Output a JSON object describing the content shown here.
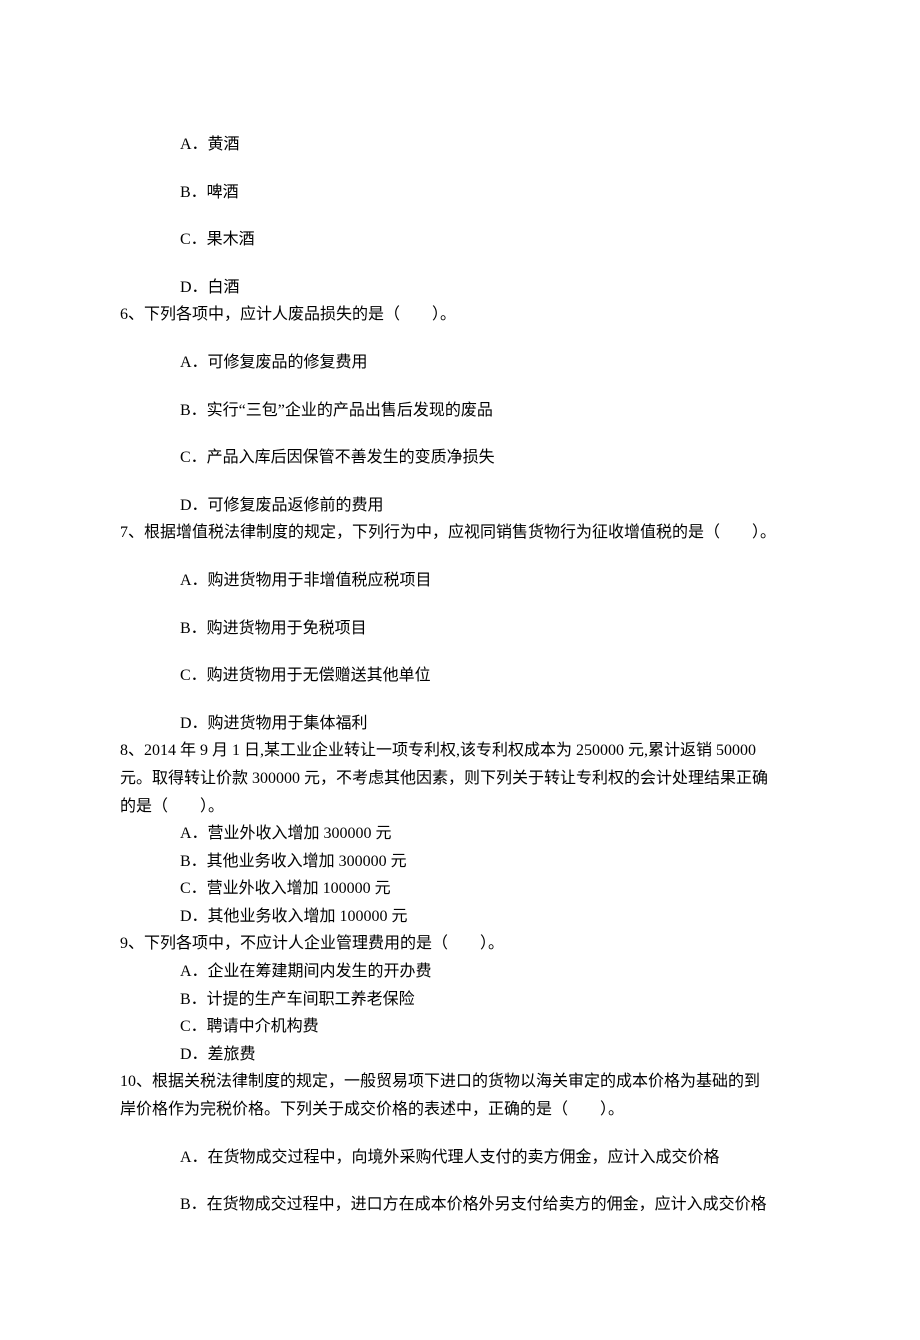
{
  "q5_tail": {
    "options": {
      "A": "A．黄酒",
      "B": "B．啤酒",
      "C": "C．果木酒",
      "D": "D．白酒"
    }
  },
  "q6": {
    "stem": "6、下列各项中，应计人废品损失的是（　　）。",
    "options": {
      "A": "A．可修复废品的修复费用",
      "B": "B．实行“三包”企业的产品出售后发现的废品",
      "C": "C．产品入库后因保管不善发生的变质净损失",
      "D": "D．可修复废品返修前的费用"
    }
  },
  "q7": {
    "stem": "7、根据增值税法律制度的规定，下列行为中，应视同销售货物行为征收增值税的是（　　）。",
    "options": {
      "A": "A．购进货物用于非增值税应税项目",
      "B": "B．购进货物用于免税项目",
      "C": "C．购进货物用于无偿赠送其他单位",
      "D": "D．购进货物用于集体福利"
    }
  },
  "q8": {
    "stem_line1": "8、2014 年 9 月 1 日,某工业企业转让一项专利权,该专利权成本为 250000 元,累计返销 50000",
    "stem_line2": "元。取得转让价款 300000 元，不考虑其他因素，则下列关于转让专利权的会计处理结果正确",
    "stem_line3": "的是（　　）。",
    "options": {
      "A": "A．营业外收入增加 300000 元",
      "B": "B．其他业务收入增加 300000 元",
      "C": "C．营业外收入增加 100000 元",
      "D": "D．其他业务收入增加 100000 元"
    }
  },
  "q9": {
    "stem": "9、下列各项中，不应计人企业管理费用的是（　　）。",
    "options": {
      "A": "A．企业在筹建期间内发生的开办费",
      "B": "B．计提的生产车间职工养老保险",
      "C": "C．聘请中介机构费",
      "D": "D．差旅费"
    }
  },
  "q10": {
    "stem_line1": "10、根据关税法律制度的规定，一般贸易项下进口的货物以海关审定的成本价格为基础的到",
    "stem_line2": "岸价格作为完税价格。下列关于成交价格的表述中，正确的是（　　）。",
    "options": {
      "A": "A．在货物成交过程中，向境外采购代理人支付的卖方佣金，应计入成交价格",
      "B": "B．在货物成交过程中，进口方在成本价格外另支付给卖方的佣金，应计入成交价格"
    }
  }
}
